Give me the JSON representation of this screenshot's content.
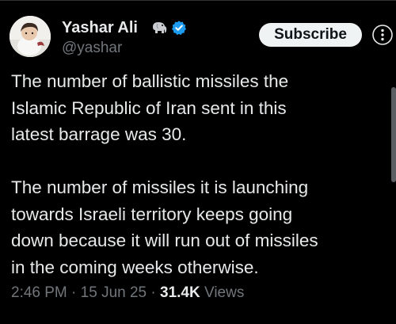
{
  "author": {
    "display_name": "Yashar Ali",
    "handle": "@yashar",
    "badges": [
      "elephant-icon",
      "verified-badge-icon"
    ]
  },
  "actions": {
    "subscribe_label": "Subscribe",
    "more_icon": "more-icon"
  },
  "tweet": {
    "paragraphs": [
      "The number of ballistic missiles the\nIslamic Republic of Iran sent in this\nlatest barrage was 30.",
      "The number of missiles it is launching\ntowards Israeli territory keeps going\ndown because it will run out of missiles\nin the coming weeks otherwise."
    ],
    "time": "2:46 PM",
    "date": "15 Jun 25",
    "separator": "·",
    "views_count": "31.4K",
    "views_label": "Views"
  },
  "colors": {
    "background": "#000000",
    "text_primary": "#e7e9ea",
    "text_secondary": "#71767b",
    "verified_blue": "#1d9bf0",
    "button_bg": "#eff3f4"
  }
}
